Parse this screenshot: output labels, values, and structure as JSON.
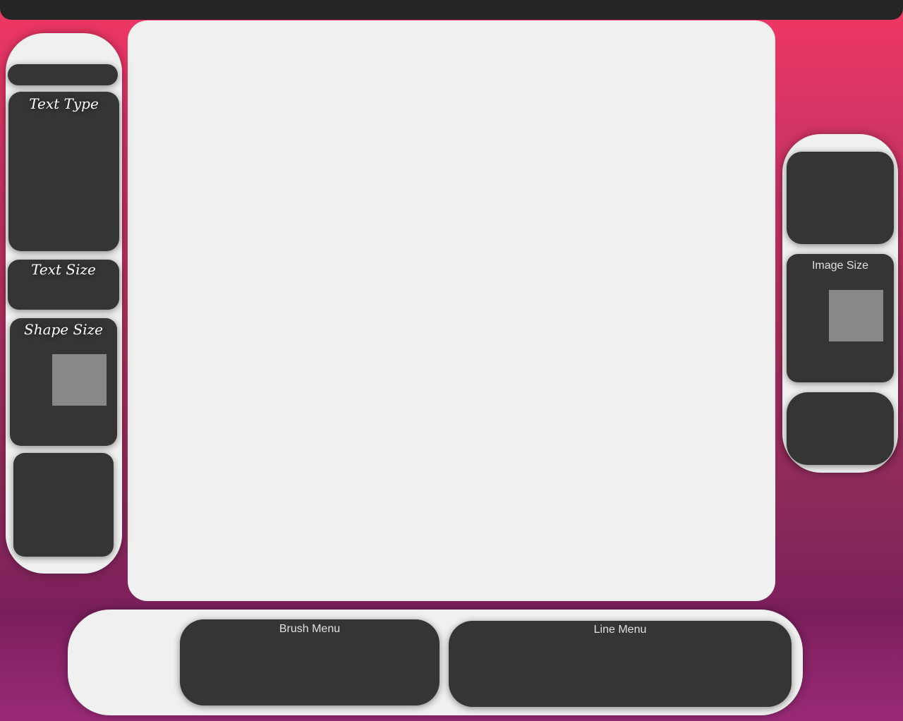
{
  "left_panel": {
    "text_type_label": "Text Type",
    "text_size_label": "Text Size",
    "shape_size_label": "Shape Size",
    "shape_size_preview_color": "#888888"
  },
  "right_panel": {
    "image_size_label": "Image Size",
    "image_size_preview_color": "#888888"
  },
  "bottom_panel": {
    "brush_menu_label": "Brush Menu",
    "line_menu_label": "Line Menu"
  },
  "colors": {
    "panel_bg": "#f0f0f0",
    "box_bg": "#353535",
    "topbar_bg": "#252525",
    "gradient_top": "#f23664",
    "gradient_bottom": "#9a2a78"
  }
}
